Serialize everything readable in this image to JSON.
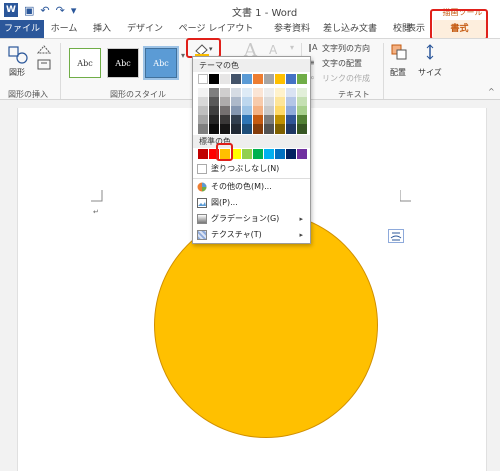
{
  "window": {
    "title": "文書 1 - Word",
    "context_tool_label": "描画ツール"
  },
  "tabs": [
    "ファイル",
    "ホーム",
    "挿入",
    "デザイン",
    "ページ レイアウト",
    "参考資料",
    "差し込み文書",
    "校閲",
    "表示",
    "書式"
  ],
  "ribbon": {
    "insert_shapes_group": "図形の挿入",
    "shape_button": "図形",
    "shape_styles_group": "図形のスタイル",
    "style_sample": "Abc",
    "wordart_letter": "A",
    "text_direction": "文字列の方向",
    "text_align": "文字の配置",
    "create_link": "リンクの作成",
    "text_group": "テキスト",
    "arrange": "配置",
    "size": "サイズ"
  },
  "fill_menu": {
    "theme_colors_header": "テーマの色",
    "standard_colors_header": "標準の色",
    "no_fill": "塗りつぶしなし(N)",
    "more_colors": "その他の色(M)...",
    "picture": "図(P)...",
    "gradient": "グラデーション(G)",
    "texture": "テクスチャ(T)",
    "theme_top": [
      "#ffffff",
      "#000000",
      "#e7e6e6",
      "#44546a",
      "#5b9bd5",
      "#ed7d31",
      "#a5a5a5",
      "#ffc000",
      "#4472c4",
      "#70ad47"
    ],
    "theme_shades": [
      [
        "#f2f2f2",
        "#7f7f7f",
        "#d0cece",
        "#d6dce4",
        "#deebf6",
        "#fbe5d5",
        "#ededed",
        "#fff2cc",
        "#dae3f3",
        "#e2efd9"
      ],
      [
        "#d8d8d8",
        "#595959",
        "#aeabab",
        "#adb9ca",
        "#bdd7ee",
        "#f7cbac",
        "#dbdbdb",
        "#fee599",
        "#b4c6e7",
        "#c5e0b3"
      ],
      [
        "#bfbfbf",
        "#3f3f3f",
        "#757070",
        "#8496b0",
        "#9cc3e5",
        "#f4b183",
        "#c9c9c9",
        "#ffd966",
        "#8eaadb",
        "#a8d08d"
      ],
      [
        "#a5a5a5",
        "#262626",
        "#3a3838",
        "#323f4f",
        "#2e75b5",
        "#c55a11",
        "#7b7b7b",
        "#bf9000",
        "#2f5496",
        "#538135"
      ],
      [
        "#7f7f7f",
        "#0c0c0c",
        "#171616",
        "#222a35",
        "#1e4e79",
        "#843c0b",
        "#525252",
        "#7f6000",
        "#1f3864",
        "#375623"
      ]
    ],
    "standard": [
      "#c00000",
      "#ff0000",
      "#ffc000",
      "#ffff00",
      "#92d050",
      "#00b050",
      "#00b0f0",
      "#0070c0",
      "#002060",
      "#7030a0"
    ]
  },
  "colors": {
    "accent": "#2b579a",
    "highlight": "#e0201a",
    "shape_fill": "#ffc000"
  }
}
